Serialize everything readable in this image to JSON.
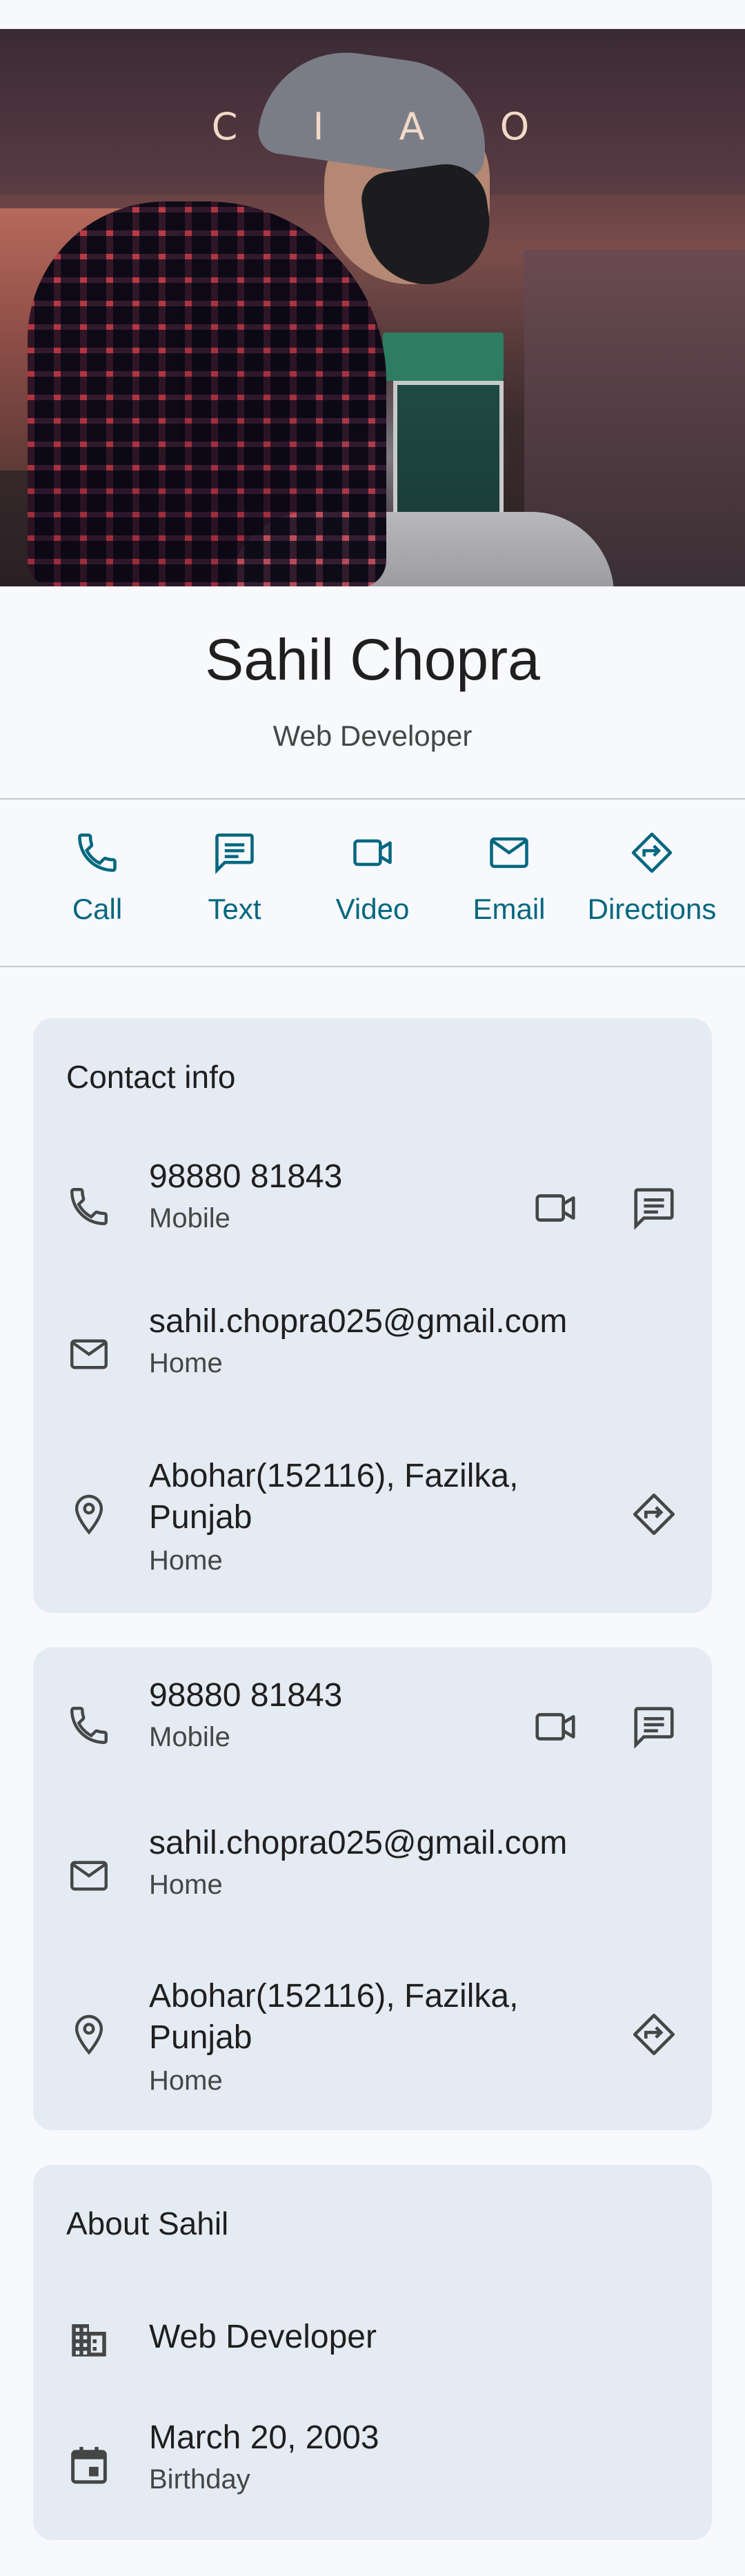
{
  "hero": {
    "overlay_text": "C I A O"
  },
  "contact": {
    "name": "Sahil Chopra",
    "subtitle": "Web Developer"
  },
  "actions": [
    {
      "label": "Call",
      "icon": "phone-icon"
    },
    {
      "label": "Text",
      "icon": "message-icon"
    },
    {
      "label": "Video",
      "icon": "video-icon"
    },
    {
      "label": "Email",
      "icon": "email-icon"
    },
    {
      "label": "Directions",
      "icon": "directions-icon"
    }
  ],
  "contact_info": {
    "title": "Contact info",
    "phone": {
      "value": "98880 81843",
      "type": "Mobile"
    },
    "email": {
      "value": "sahil.chopra025@gmail.com",
      "type": "Home"
    },
    "address": {
      "line1": "Abohar(152116), Fazilka,",
      "line2": "Punjab",
      "type": "Home"
    }
  },
  "contact_info_2": {
    "phone": {
      "value": "98880 81843",
      "type": "Mobile"
    },
    "email": {
      "value": "sahil.chopra025@gmail.com",
      "type": "Home"
    },
    "address": {
      "line1": "Abohar(152116), Fazilka,",
      "line2": "Punjab",
      "type": "Home"
    }
  },
  "about": {
    "title": "About Sahil",
    "work": "Web Developer",
    "birthday": {
      "value": "March 20, 2003",
      "label": "Birthday"
    }
  },
  "colors": {
    "accent": "#00677f",
    "card": "#e5ebf2",
    "background": "#f8f9fc",
    "icon": "#444746"
  }
}
